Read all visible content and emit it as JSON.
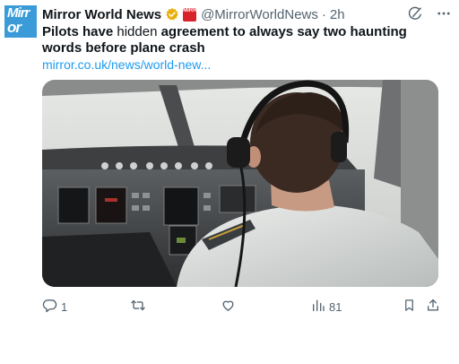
{
  "account": {
    "avatar_line1": "Mirr",
    "avatar_line2": "or",
    "name": "Mirror World News",
    "affiliate_badge": "MIRROR",
    "handle": "@MirrorWorldNews",
    "separator": "·",
    "time": "2h"
  },
  "tweet": {
    "text_part1": "Pilots have ",
    "text_highlight": "hidden",
    "text_part2": " agreement to always say two haunting words before plane crash",
    "link_text": "mirror.co.uk/news/world-new..."
  },
  "actions": {
    "reply_count": "1",
    "views_count": "81"
  },
  "icons": {
    "verified": "verified-badge-icon",
    "grok": "grok-icon",
    "more": "more-icon",
    "reply": "reply-icon",
    "retweet": "retweet-icon",
    "like": "like-icon",
    "views": "views-icon",
    "bookmark": "bookmark-icon",
    "share": "share-icon"
  },
  "colors": {
    "link": "#1d9bf0",
    "verified": "#e8b00f",
    "secondary_text": "#536471"
  }
}
